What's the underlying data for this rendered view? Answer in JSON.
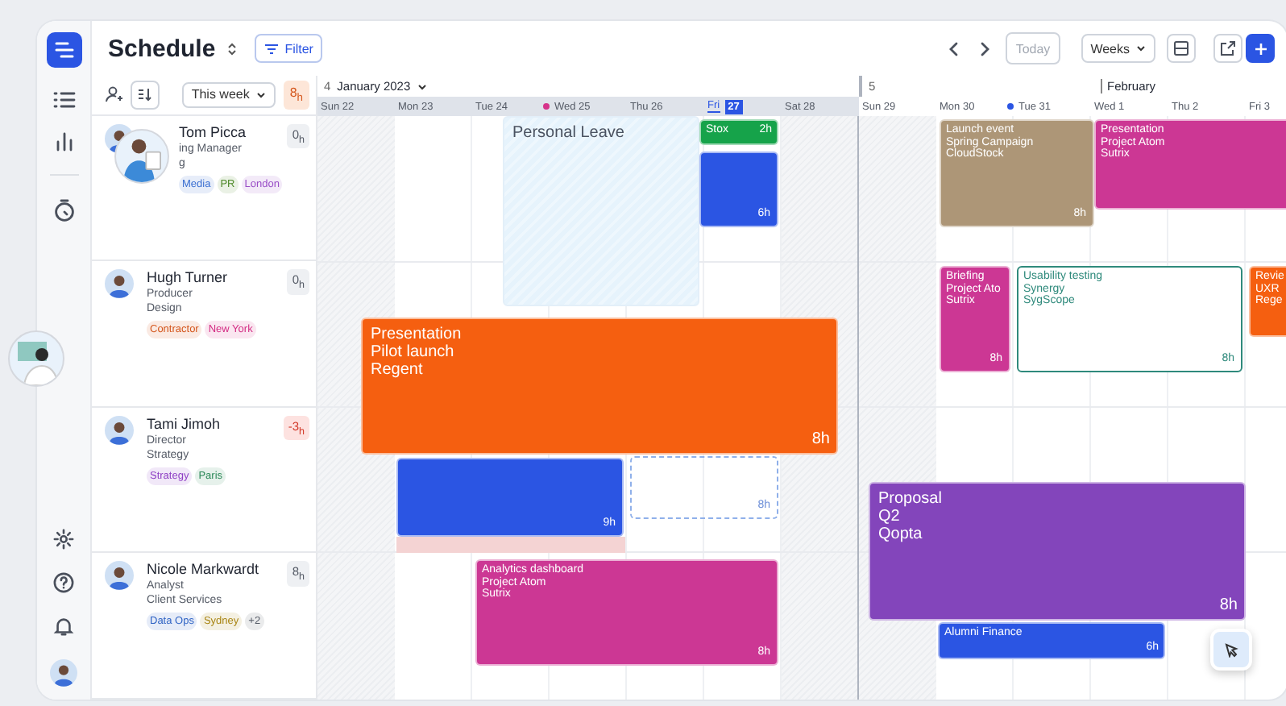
{
  "header": {
    "title": "Schedule",
    "filter": "Filter",
    "today": "Today",
    "view": "Weeks"
  },
  "people_toolbar": {
    "period": "This week",
    "total": "8$_{h}$"
  },
  "people": [
    {
      "name": "Tom Picca",
      "role": "ing Manager",
      "department": "g",
      "hours": "0$_{h}$",
      "overbooked": false,
      "dragging": true,
      "tags": [
        {
          "label": "Media",
          "color": "#3b6fd1"
        },
        {
          "label": "PR",
          "color": "#4f8a2a"
        },
        {
          "label": "London",
          "color": "#9a4fc7"
        }
      ]
    },
    {
      "name": "Hugh Turner",
      "role": "Producer",
      "department": "Design",
      "hours": "0$_{h}$",
      "overbooked": false,
      "dragging": false,
      "tags": [
        {
          "label": "Contractor",
          "color": "#d4561c"
        },
        {
          "label": "New York",
          "color": "#d42f85"
        }
      ]
    },
    {
      "name": "Tami Jimoh",
      "role": "Director",
      "department": "Strategy",
      "hours": "-3$_{h}$",
      "overbooked": true,
      "dragging": false,
      "tags": [
        {
          "label": "Strategy",
          "color": "#8e3fc4"
        },
        {
          "label": "Paris",
          "color": "#2e8a5a"
        }
      ]
    },
    {
      "name": "Nicole Markwardt",
      "role": "Analyst",
      "department": "Client Services",
      "hours": "8$_{h}$",
      "overbooked": false,
      "dragging": false,
      "tags": [
        {
          "label": "Data Ops",
          "color": "#2f63c4"
        },
        {
          "label": "Sydney",
          "color": "#a88412"
        },
        {
          "label": "+2",
          "color": "#555b66"
        }
      ]
    }
  ],
  "weeks": [
    {
      "number": "4",
      "label": "January 2023",
      "highlighted": true,
      "days": [
        {
          "label": "Sun 22",
          "selected": false
        },
        {
          "label": "Mon 23",
          "selected": false
        },
        {
          "label": "Tue 24",
          "selected": false
        },
        {
          "label": "Wed 25",
          "selected": false,
          "color": "#d6338a"
        },
        {
          "label": "Thu 26",
          "selected": false
        },
        {
          "label": "Fri",
          "date": "27",
          "selected": true
        },
        {
          "label": "Sat 28",
          "selected": false
        }
      ]
    },
    {
      "number": "5",
      "month": "February",
      "highlighted": false,
      "days": [
        {
          "label": "Sun 29",
          "selected": false
        },
        {
          "label": "Mon 30",
          "selected": false
        },
        {
          "label": "Tue 31",
          "selected": false,
          "color": "#2b55e3"
        },
        {
          "label": "Wed 1",
          "selected": false
        },
        {
          "label": "Thu 2",
          "selected": false
        },
        {
          "label": "Fri 3",
          "selected": false
        }
      ]
    }
  ],
  "events": [
    {
      "kind": "leave",
      "lines": [
        "Personal Leave"
      ]
    },
    {
      "kind": "booking",
      "lines": [
        "Stox"
      ],
      "hours": "2h",
      "color": "#16a34a"
    },
    {
      "kind": "booking",
      "hours": "6h",
      "color": "#2b55e3"
    },
    {
      "kind": "booking",
      "lines": [
        "Presentation",
        "Pilot launch",
        "Regent"
      ],
      "hours": "8h",
      "color": "#f55f10"
    },
    {
      "kind": "booking",
      "hours": "9h",
      "color": "#2b55e3"
    },
    {
      "kind": "overtime"
    },
    {
      "kind": "placeholder",
      "hours": "8h"
    },
    {
      "kind": "booking",
      "lines": [
        "Analytics dashboard",
        "Project Atom",
        "Sutrix"
      ],
      "hours": "8h",
      "color": "#cc3794"
    },
    {
      "kind": "booking",
      "lines": [
        "Launch event",
        "Spring Campaign",
        "CloudStock"
      ],
      "hours": "8h",
      "color": "#ad9677"
    },
    {
      "kind": "booking",
      "lines": [
        "Presentation",
        "Project Atom",
        "Sutrix"
      ],
      "color": "#cc3794"
    },
    {
      "kind": "booking",
      "lines": [
        "Briefing",
        "Project Ato",
        "Sutrix"
      ],
      "hours": "8h",
      "color": "#cc3794"
    },
    {
      "kind": "tentative",
      "lines": [
        "Usability testing",
        "Synergy",
        "SygScope"
      ],
      "hours": "8h",
      "color": "#2f8a7c"
    },
    {
      "kind": "booking",
      "lines": [
        "Revie",
        "UXR",
        "Rege"
      ],
      "color": "#f55f10"
    },
    {
      "kind": "booking",
      "lines": [
        "Proposal",
        "Q2",
        "Qopta"
      ],
      "hours": "8h",
      "color": "#8345bb"
    },
    {
      "kind": "booking",
      "lines": [
        "Alumni Finance"
      ],
      "hours": "6h",
      "color": "#2b55e3"
    }
  ]
}
